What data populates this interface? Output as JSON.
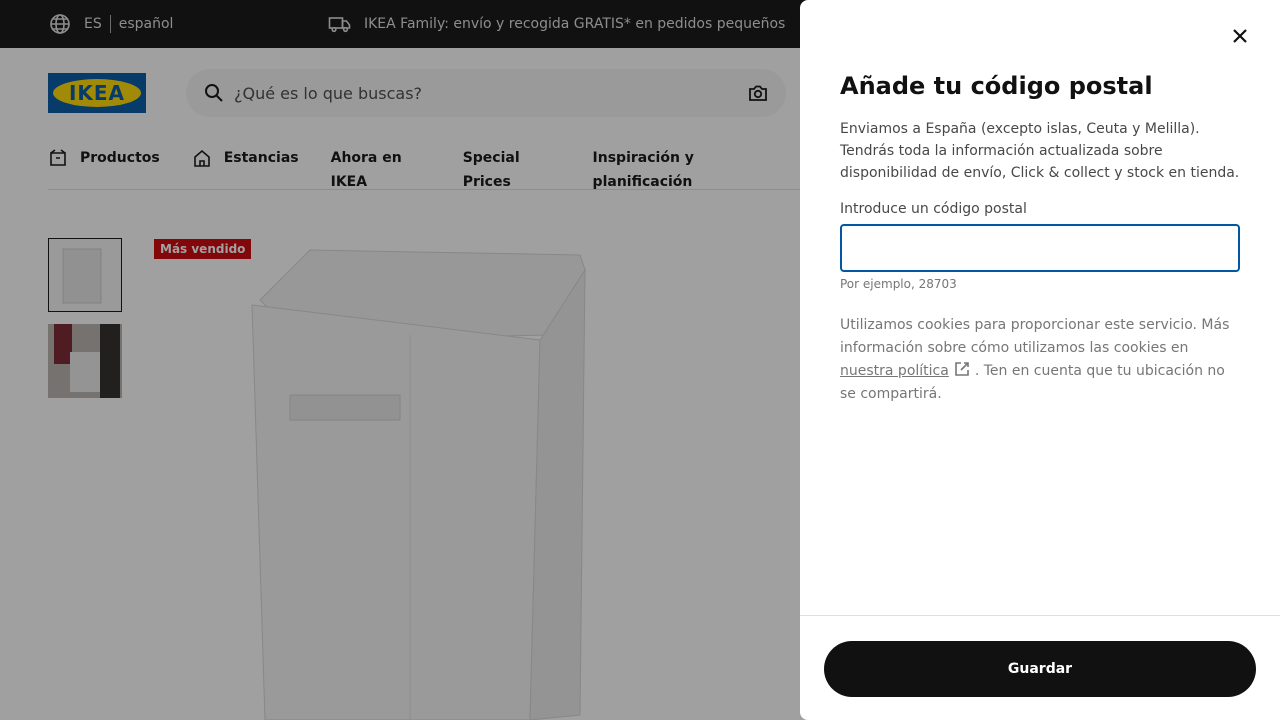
{
  "topbar": {
    "lang_code": "ES",
    "lang_name": "español",
    "promo": "IKEA Family: envío y recogida GRATIS* en pedidos pequeños"
  },
  "header": {
    "logo_text": "IKEA",
    "search_placeholder": "¿Qué es lo que buscas?"
  },
  "nav": {
    "items": [
      {
        "label": "Productos",
        "icon": "box-icon"
      },
      {
        "label": "Estancias",
        "icon": "home-icon"
      },
      {
        "label": "Ahora en IKEA"
      },
      {
        "label": "Special Prices"
      },
      {
        "label": "Inspiración y planificación"
      }
    ]
  },
  "product": {
    "badge": "Más vendido"
  },
  "panel": {
    "title": "Añade tu código postal",
    "description": "Enviamos a España (excepto islas, Ceuta y Melilla). Tendrás toda la información actualizada sobre disponibilidad de envío, Click & collect y stock en tienda.",
    "input_label": "Introduce un código postal",
    "input_value": "",
    "hint": "Por ejemplo, 28703",
    "cookies_text_1": "Utilizamos cookies para proporcionar este servicio. Más información sobre cómo utilizamos las cookies en",
    "cookies_link": "nuestra política",
    "cookies_text_2": ". Ten en cuenta que tu ubicación no se compartirá.",
    "save_label": "Guardar"
  },
  "colors": {
    "brand_blue": "#0058a3",
    "brand_yellow": "#ffdb00",
    "badge_red": "#cc0008",
    "button_dark": "#111111"
  }
}
